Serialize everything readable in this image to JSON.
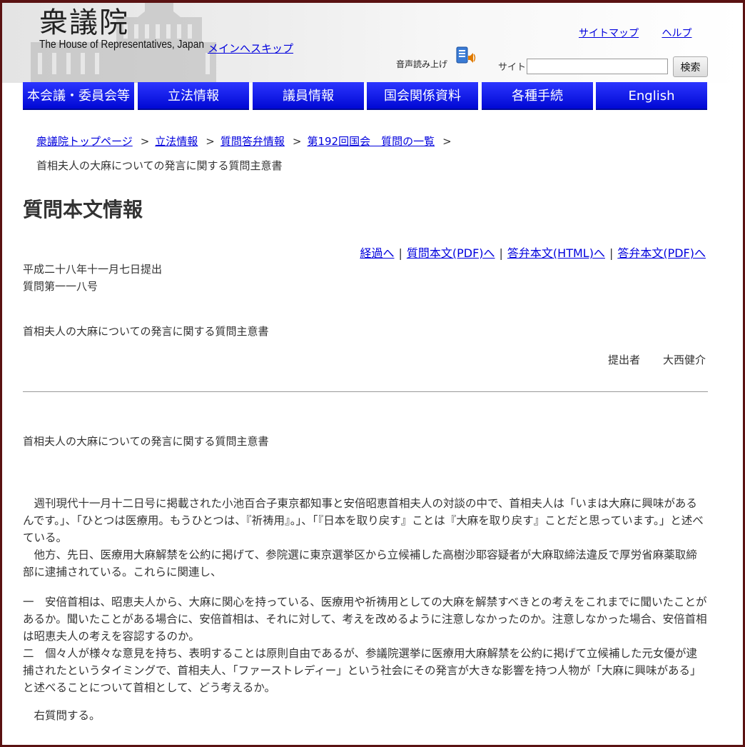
{
  "header": {
    "logo_kanji": "衆議院",
    "logo_en": "The House of Representatives, Japan",
    "skip_link": "メインへスキップ",
    "sitemap": "サイトマップ",
    "help": "ヘルプ",
    "voice_label": "音声読み上げ",
    "voice_icon": "speaker-book-icon",
    "site_label": "サイト",
    "search_value": "",
    "search_button": "検索"
  },
  "nav": {
    "items": [
      {
        "label": "本会議・委員会等"
      },
      {
        "label": "立法情報"
      },
      {
        "label": "議員情報"
      },
      {
        "label": "国会関係資料"
      },
      {
        "label": "各種手続"
      },
      {
        "label": "English"
      }
    ]
  },
  "breadcrumb": {
    "items": [
      "衆議院トップページ",
      "立法情報",
      "質問答弁情報",
      "第192回国会　質問の一覧"
    ],
    "separator": ">",
    "current": "首相夫人の大麻についての発言に関する質問主意書"
  },
  "page_title": "質問本文情報",
  "doc_links": {
    "progress": "経過へ",
    "question_pdf": "質問本文(PDF)へ",
    "answer_html": "答弁本文(HTML)へ",
    "answer_pdf": "答弁本文(PDF)へ",
    "bar": "|"
  },
  "meta": {
    "date": "平成二十八年十一月七日提出",
    "number": "質問第一一八号"
  },
  "question_title": "首相夫人の大麻についての発言に関する質問主意書",
  "submitter": {
    "label": "提出者",
    "name": "大西健介"
  },
  "body": {
    "title": "首相夫人の大麻についての発言に関する質問主意書",
    "p1": "　週刊現代十一月十二日号に掲載された小池百合子東京都知事と安倍昭恵首相夫人の対談の中で、首相夫人は「いまは大麻に興味があるんです。」、「ひとつは医療用。もうひとつは、『祈祷用』。」、「『日本を取り戻す』ことは『大麻を取り戻す』ことだと思っています。」と述べている。",
    "p2": "　他方、先日、医療用大麻解禁を公約に掲げて、参院選に東京選挙区から立候補した高樹沙耶容疑者が大麻取締法違反で厚労省麻薬取締部に逮捕されている。これらに関連し、",
    "p3": "一　安倍首相は、昭恵夫人から、大麻に関心を持っている、医療用や祈祷用としての大麻を解禁すべきとの考えをこれまでに聞いたことがあるか。聞いたことがある場合に、安倍首相は、それに対して、考えを改めるように注意しなかったのか。注意しなかった場合、安倍首相は昭恵夫人の考えを容認するのか。",
    "p4": "二　個々人が様々な意見を持ち、表明することは原則自由であるが、参議院選挙に医療用大麻解禁を公約に掲げて立候補した元女優が逮捕されたというタイミングで、首相夫人、「ファーストレディー」という社会にその発言が大きな影響を持つ人物が「大麻に興味がある」と述べることについて首相として、どう考えるか。",
    "p5": "　右質問する。"
  }
}
